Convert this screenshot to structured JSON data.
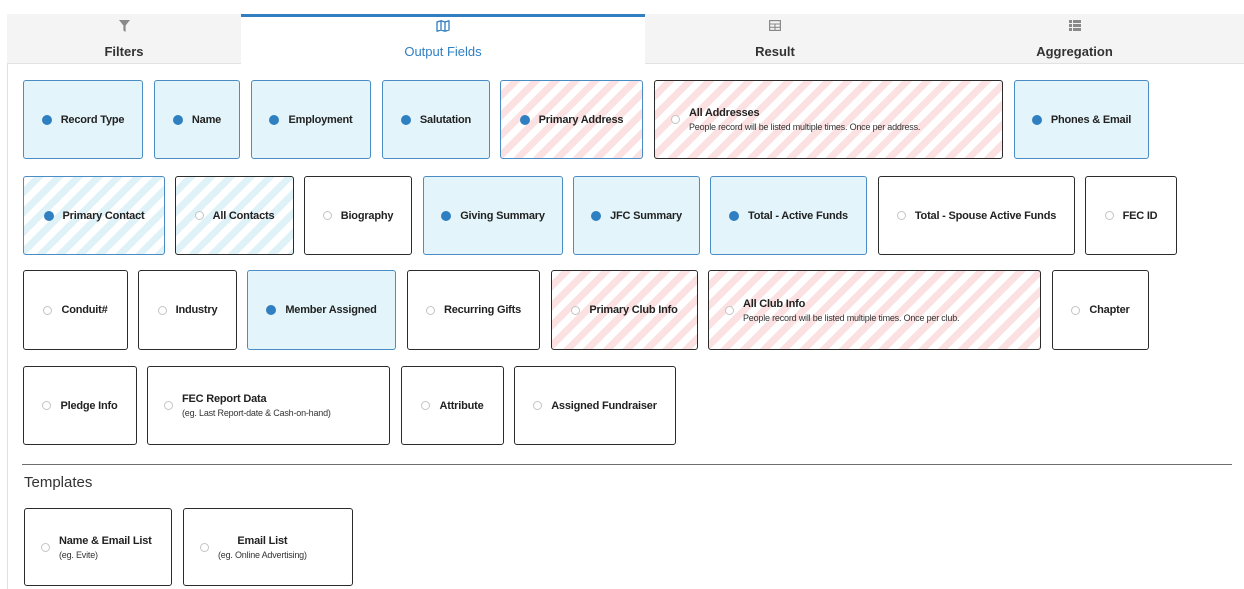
{
  "tabs": [
    {
      "label": "Filters",
      "icon": "filter-icon",
      "active": false
    },
    {
      "label": "Output Fields",
      "icon": "map-icon",
      "active": true
    },
    {
      "label": "Result",
      "icon": "table-icon",
      "active": false
    },
    {
      "label": "Aggregation",
      "icon": "list-icon",
      "active": false
    }
  ],
  "fields": [
    {
      "label": "Record Type",
      "selected": true
    },
    {
      "label": "Name",
      "selected": true
    },
    {
      "label": "Employment",
      "selected": true
    },
    {
      "label": "Salutation",
      "selected": true
    },
    {
      "label": "Primary Address",
      "selected": true,
      "pattern": "red-stripes"
    },
    {
      "label": "All Addresses",
      "note": "People record will be listed multiple times. Once per address.",
      "selected": false,
      "pattern": "red-stripes"
    },
    {
      "label": "Phones & Email",
      "selected": true
    },
    {
      "label": "Primary Contact",
      "selected": true,
      "pattern": "blue-stripes"
    },
    {
      "label": "All Contacts",
      "selected": false,
      "pattern": "blue-stripes"
    },
    {
      "label": "Biography",
      "selected": false
    },
    {
      "label": "Giving Summary",
      "selected": true
    },
    {
      "label": "JFC Summary",
      "selected": true
    },
    {
      "label": "Total - Active Funds",
      "selected": true
    },
    {
      "label": "Total - Spouse Active Funds",
      "selected": false
    },
    {
      "label": "FEC ID",
      "selected": false
    },
    {
      "label": "Conduit#",
      "selected": false
    },
    {
      "label": "Industry",
      "selected": false
    },
    {
      "label": "Member Assigned",
      "selected": true
    },
    {
      "label": "Recurring Gifts",
      "selected": false
    },
    {
      "label": "Primary Club Info",
      "selected": false,
      "pattern": "red-stripes"
    },
    {
      "label": "All Club Info",
      "note": "People record will be listed multiple times. Once per club.",
      "selected": false,
      "pattern": "red-stripes"
    },
    {
      "label": "Chapter",
      "selected": false
    },
    {
      "label": "Pledge Info",
      "selected": false
    },
    {
      "label": "FEC Report Data",
      "note": "(eg. Last Report-date & Cash-on-hand)",
      "selected": false
    },
    {
      "label": "Attribute",
      "selected": false
    },
    {
      "label": "Assigned Fundraiser",
      "selected": false
    }
  ],
  "templates_heading": "Templates",
  "templates": [
    {
      "label": "Name & Email List",
      "note": "(eg. Evite)",
      "selected": false
    },
    {
      "label": "Email List",
      "note": "(eg. Online Advertising)",
      "selected": false
    }
  ]
}
